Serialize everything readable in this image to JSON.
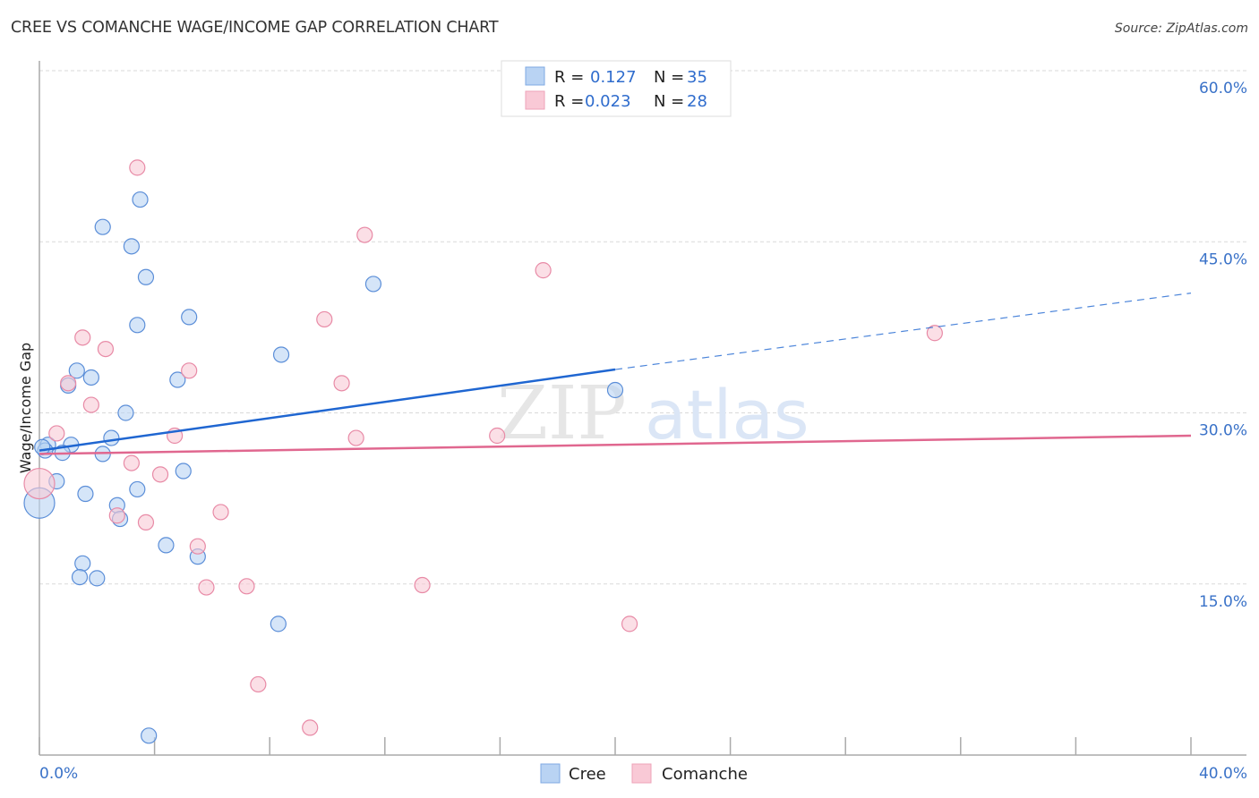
{
  "title": "CREE VS COMANCHE WAGE/INCOME GAP CORRELATION CHART",
  "source": "Source: ZipAtlas.com",
  "watermark": {
    "zip": "ZIP",
    "atlas": "atlas"
  },
  "colors": {
    "cree_fill": "#b9d3f3",
    "cree_stroke": "#5b8ed8",
    "cree_line": "#1f66d1",
    "comanche_fill": "#f9c9d6",
    "comanche_stroke": "#e88aa6",
    "comanche_line": "#e0678f",
    "tick_text": "#3a72c8",
    "grid": "#d9d9d9",
    "axis": "#aaaaaa"
  },
  "legend": {
    "rows": [
      {
        "series": "Cree",
        "r_label": "R =",
        "r_value": "0.127",
        "n_label": "N =",
        "n_value": "35"
      },
      {
        "series": "Comanche",
        "r_label": "R =",
        "r_value": "0.023",
        "n_label": "N =",
        "n_value": "28"
      }
    ]
  },
  "bottom_legend": [
    "Cree",
    "Comanche"
  ],
  "chart_data": {
    "type": "scatter",
    "title": "CREE VS COMANCHE WAGE/INCOME GAP CORRELATION CHART",
    "xlabel": "",
    "ylabel": "Wage/Income Gap",
    "xlim": [
      0,
      40
    ],
    "ylim": [
      0,
      63
    ],
    "x_tick_labels": [
      "0.0%",
      "40.0%"
    ],
    "x_minor_ticks": [
      0,
      4,
      8,
      12,
      16,
      20,
      24,
      28,
      32,
      36,
      40
    ],
    "y_ticks": [
      15,
      30,
      45,
      60
    ],
    "y_tick_labels": [
      "15.0%",
      "30.0%",
      "45.0%",
      "60.0%"
    ],
    "grid": "horizontal dashed",
    "legend_placement": "top-center",
    "series": [
      {
        "name": "Cree",
        "R": 0.127,
        "N": 35,
        "points": [
          [
            3.5,
            48.7
          ],
          [
            2.2,
            46.3
          ],
          [
            3.2,
            44.6
          ],
          [
            3.7,
            41.9
          ],
          [
            11.6,
            41.3
          ],
          [
            5.2,
            38.4
          ],
          [
            3.4,
            37.7
          ],
          [
            8.4,
            35.1
          ],
          [
            1.3,
            33.7
          ],
          [
            1.8,
            33.1
          ],
          [
            4.8,
            32.9
          ],
          [
            1.0,
            32.4
          ],
          [
            20.0,
            32.0
          ],
          [
            3.0,
            30.0
          ],
          [
            0.3,
            27.2
          ],
          [
            1.1,
            27.2
          ],
          [
            2.5,
            27.8
          ],
          [
            0.2,
            26.7
          ],
          [
            0.8,
            26.5
          ],
          [
            2.2,
            26.4
          ],
          [
            5.0,
            24.9
          ],
          [
            0.6,
            24.0
          ],
          [
            0.0,
            22.1
          ],
          [
            1.6,
            22.9
          ],
          [
            3.4,
            23.3
          ],
          [
            2.7,
            21.9
          ],
          [
            2.8,
            20.7
          ],
          [
            4.4,
            18.4
          ],
          [
            5.5,
            17.4
          ],
          [
            1.5,
            16.8
          ],
          [
            1.4,
            15.6
          ],
          [
            2.0,
            15.5
          ],
          [
            8.3,
            11.5
          ],
          [
            3.8,
            1.7
          ],
          [
            0.1,
            27.0
          ]
        ],
        "large_points": [
          [
            0.0,
            22.1
          ]
        ],
        "trend": {
          "x_solid": [
            0,
            20
          ],
          "y_solid": [
            26.7,
            33.8
          ],
          "x_dashed": [
            20,
            40
          ],
          "y_dashed": [
            33.8,
            40.5
          ]
        }
      },
      {
        "name": "Comanche",
        "R": 0.023,
        "N": 28,
        "points": [
          [
            3.4,
            51.5
          ],
          [
            11.3,
            45.6
          ],
          [
            17.5,
            42.5
          ],
          [
            9.9,
            38.2
          ],
          [
            1.5,
            36.6
          ],
          [
            2.3,
            35.6
          ],
          [
            31.1,
            37.0
          ],
          [
            5.2,
            33.7
          ],
          [
            1.0,
            32.6
          ],
          [
            10.5,
            32.6
          ],
          [
            1.8,
            30.7
          ],
          [
            0.6,
            28.2
          ],
          [
            4.7,
            28.0
          ],
          [
            11.0,
            27.8
          ],
          [
            15.9,
            28.0
          ],
          [
            3.2,
            25.6
          ],
          [
            4.2,
            24.6
          ],
          [
            0.0,
            23.8
          ],
          [
            6.3,
            21.3
          ],
          [
            2.7,
            21.0
          ],
          [
            3.7,
            20.4
          ],
          [
            5.5,
            18.3
          ],
          [
            5.8,
            14.7
          ],
          [
            7.2,
            14.8
          ],
          [
            13.3,
            14.9
          ],
          [
            20.5,
            11.5
          ],
          [
            7.6,
            6.2
          ],
          [
            9.4,
            2.4
          ]
        ],
        "large_points": [
          [
            0.0,
            23.8
          ]
        ],
        "trend": {
          "x_solid": [
            0,
            40
          ],
          "y_solid": [
            26.4,
            28.0
          ]
        }
      }
    ]
  }
}
